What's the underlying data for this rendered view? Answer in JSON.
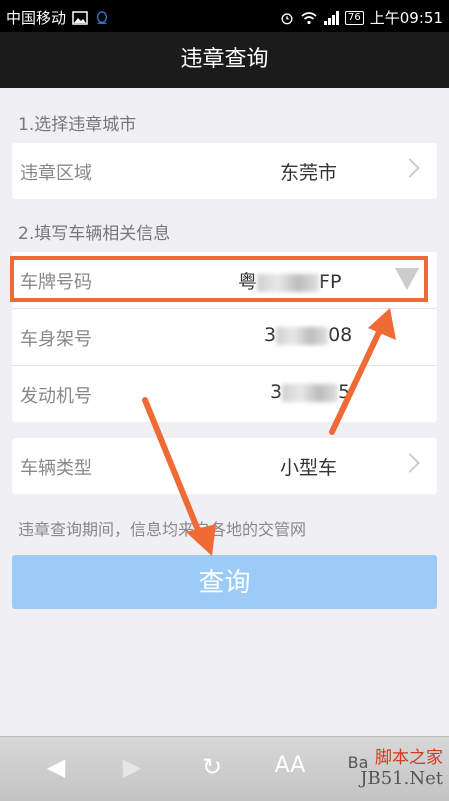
{
  "status_bar": {
    "carrier": "中国移动",
    "battery": "76",
    "time": "上午09:51"
  },
  "header": {
    "title": "违章查询"
  },
  "section1": {
    "label": "1.选择违章城市",
    "region_label": "违章区域",
    "region_value": "东莞市"
  },
  "section2": {
    "label": "2.填写车辆相关信息",
    "plate_label": "车牌号码",
    "plate_prefix": "粤",
    "plate_suffix": "FP",
    "frame_label": "车身架号",
    "frame_prefix": "3",
    "frame_suffix": "08",
    "engine_label": "发动机号",
    "engine_prefix": "3",
    "engine_suffix": "5",
    "type_label": "车辆类型",
    "type_value": "小型车"
  },
  "note": "违章查询期间，信息均来自各地的交管网",
  "query_button": "查询",
  "watermark": {
    "line1": "脚本之家",
    "line2": "JB51.Net",
    "partial": "Ba"
  },
  "colors": {
    "highlight": "#f06a35",
    "button": "#9ccbf7",
    "title_bg": "#1b1b1b"
  }
}
